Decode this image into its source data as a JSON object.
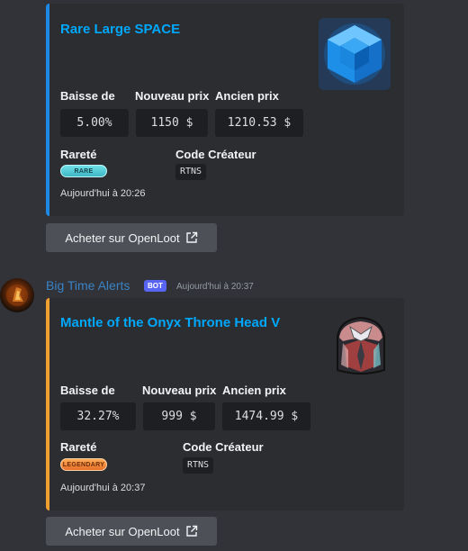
{
  "labels": {
    "drop": "Baisse de",
    "new_price": "Nouveau prix",
    "old_price": "Ancien prix",
    "rarity": "Rareté",
    "creator_code": "Code Créateur"
  },
  "embeds": [
    {
      "title": "Rare Large SPACE",
      "drop": "5.00%",
      "new_price": "1150 $",
      "old_price": "1210.53 $",
      "rarity_badge": "RARE",
      "creator_code": "RTNS",
      "footer_time": "Aujourd'hui à 20:26",
      "accent_color": "#1e88e5",
      "thumbnail_icon": "blue-cube-icon",
      "button": {
        "label": "Acheter sur OpenLoot",
        "icon": "external-link-icon"
      }
    },
    {
      "title": "Mantle of the Onyx Throne Head V",
      "drop": "32.27%",
      "new_price": "999 $",
      "old_price": "1474.99 $",
      "rarity_badge": "LEGENDARY",
      "creator_code": "RTNS",
      "footer_time": "Aujourd'hui à 20:37",
      "accent_color": "#f0a030",
      "thumbnail_icon": "helmet-icon",
      "button": {
        "label": "Acheter sur OpenLoot",
        "icon": "external-link-icon"
      }
    }
  ],
  "message": {
    "author": "Big Time Alerts",
    "bot_tag": "BOT",
    "time": "Aujourd'hui à 20:37"
  }
}
